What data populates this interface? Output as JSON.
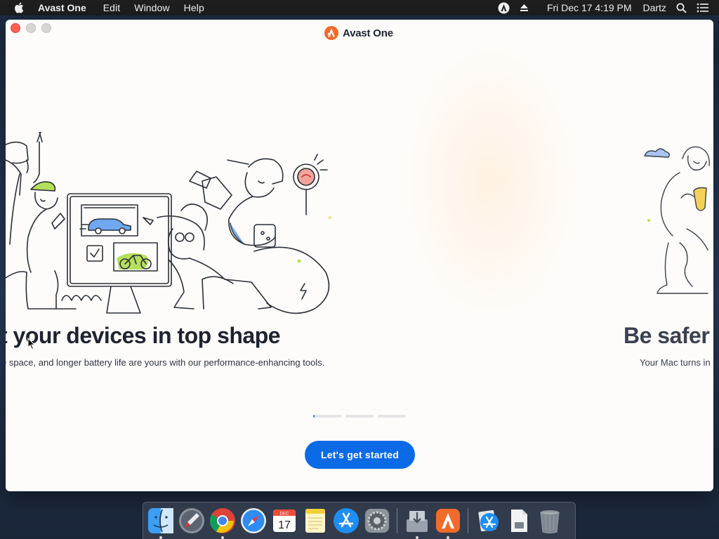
{
  "menubar": {
    "app_name": "Avast One",
    "menus": [
      "Edit",
      "Window",
      "Help"
    ],
    "clock": "Fri Dec 17  4:19 PM",
    "user": "Dartz",
    "icons": [
      "apple-icon",
      "avast-status-icon",
      "eject-icon",
      "spotlight-icon",
      "notification-list-icon"
    ]
  },
  "window": {
    "brand": "Avast One",
    "brand_color": "#f26b2a",
    "slides": [
      {
        "title": "t your devices in top shape",
        "body": "e space, and longer battery life are yours with our performance-enhancing tools."
      },
      {
        "title": "Be safer",
        "body": "Your Mac turns in"
      }
    ],
    "pager": {
      "count": 3,
      "active_index": 0,
      "active_progress": 0.05
    },
    "cta_label": "Let's get started",
    "accent_color": "#0b6ae6"
  },
  "dock": {
    "apps": [
      {
        "name": "Finder",
        "icon": "finder-icon",
        "running": true
      },
      {
        "name": "Launchpad",
        "icon": "launchpad-icon",
        "running": false
      },
      {
        "name": "Google Chrome",
        "icon": "chrome-icon",
        "running": true
      },
      {
        "name": "Safari",
        "icon": "safari-icon",
        "running": false
      },
      {
        "name": "Calendar",
        "icon": "calendar-icon",
        "running": false,
        "month": "DEC",
        "day": "17"
      },
      {
        "name": "Notes",
        "icon": "notes-icon",
        "running": false
      },
      {
        "name": "App Store",
        "icon": "app-store-icon",
        "running": false
      },
      {
        "name": "System Preferences",
        "icon": "system-preferences-icon",
        "running": false
      },
      {
        "name": "Installer",
        "icon": "installer-icon",
        "running": true
      },
      {
        "name": "Avast One",
        "icon": "avast-icon",
        "running": true
      },
      {
        "name": "App Store Downloads",
        "icon": "downloads-icon",
        "running": false
      },
      {
        "name": "Document",
        "icon": "document-icon",
        "running": false
      },
      {
        "name": "Trash",
        "icon": "trash-icon",
        "running": false
      }
    ]
  }
}
